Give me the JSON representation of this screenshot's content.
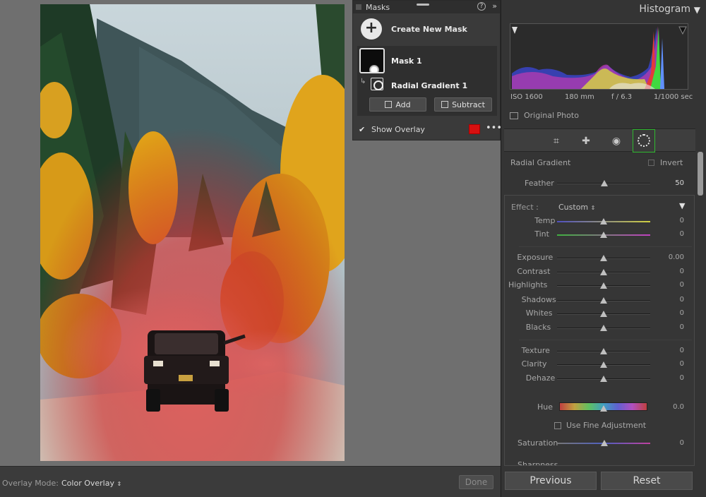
{
  "masks_panel": {
    "title": "Masks",
    "help_glyph": "?",
    "more_glyph": "»",
    "create_label": "Create New Mask",
    "mask_name": "Mask 1",
    "component_name": "Radial Gradient 1",
    "add_label": "Add",
    "subtract_label": "Subtract",
    "show_overlay_label": "Show Overlay",
    "show_overlay_checked": true,
    "overlay_color": "#d81010"
  },
  "bottom_bar": {
    "overlay_mode_label": "Overlay Mode:",
    "overlay_mode_value": "Color Overlay",
    "done_label": "Done"
  },
  "histogram": {
    "title": "Histogram",
    "iso": "ISO 1600",
    "focal": "180 mm",
    "aperture": "f / 6.3",
    "shutter": "1/1000 sec",
    "original_photo_label": "Original Photo"
  },
  "tool_icons": [
    "crop-icon",
    "healing-icon",
    "red-eye-icon",
    "masking-icon"
  ],
  "mask_settings": {
    "tool_label": "Radial Gradient",
    "invert_label": "Invert",
    "feather_label": "Feather",
    "feather_value": "50",
    "effect_label": "Effect :",
    "effect_value": "Custom",
    "hue_label": "Hue",
    "hue_value": "0.0",
    "fine_adjust_label": "Use Fine Adjustment",
    "saturation_label": "Saturation",
    "saturation_value": "0",
    "sharpness_label": "Sharpness"
  },
  "sliders": [
    {
      "label": "Temp",
      "value": "0",
      "level": 0.5
    },
    {
      "label": "Tint",
      "value": "0",
      "level": 0.5
    },
    {
      "label": "Exposure",
      "value": "0.00",
      "level": 0.5
    },
    {
      "label": "Contrast",
      "value": "0",
      "level": 0.5
    },
    {
      "label": "Highlights",
      "value": "0",
      "level": 0.5
    },
    {
      "label": "Shadows",
      "value": "0",
      "level": 0.5
    },
    {
      "label": "Whites",
      "value": "0",
      "level": 0.5
    },
    {
      "label": "Blacks",
      "value": "0",
      "level": 0.5
    },
    {
      "label": "Texture",
      "value": "0",
      "level": 0.5
    },
    {
      "label": "Clarity",
      "value": "0",
      "level": 0.5
    },
    {
      "label": "Dehaze",
      "value": "0",
      "level": 0.5
    }
  ],
  "footer": {
    "previous_label": "Previous",
    "reset_label": "Reset"
  }
}
